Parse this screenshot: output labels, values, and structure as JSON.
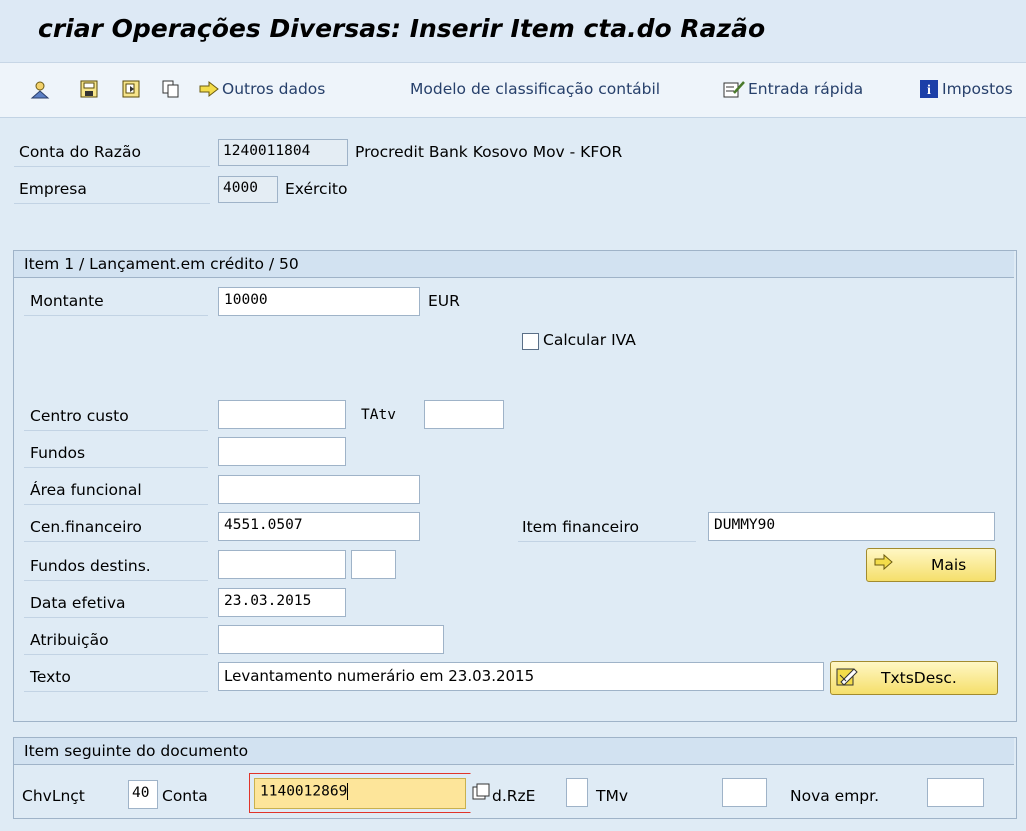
{
  "title": "criar Operações Diversas: Inserir Item cta.do Razão",
  "toolbar": {
    "icons": [
      "person-icon",
      "save-icon",
      "template-icon",
      "copy-icon"
    ],
    "outros_dados": "Outros dados",
    "modelo": "Modelo de classificação contábil",
    "entrada_rapida": "Entrada rápida",
    "impostos": "Impostos"
  },
  "header": {
    "conta_label": "Conta do Razão",
    "conta_value": "1240011804",
    "conta_desc": "Procredit Bank Kosovo Mov - KFOR",
    "empresa_label": "Empresa",
    "empresa_value": "4000",
    "empresa_desc": "Exército"
  },
  "item": {
    "heading": "Item 1 / Lançament.em crédito / 50",
    "montante_label": "Montante",
    "montante_value": "10000",
    "currency": "EUR",
    "calcular_iva": "Calcular IVA",
    "centro_custo_label": "Centro custo",
    "centro_custo_value": "",
    "tatv_label": "TAtv",
    "tatv_value": "",
    "fundos_label": "Fundos",
    "fundos_value": "",
    "area_label": "Área funcional",
    "area_value": "",
    "cenfin_label": "Cen.financeiro",
    "cenfin_value": "4551.0507",
    "itemfin_label": "Item financeiro",
    "itemfin_value": "DUMMY90",
    "mais_label": "Mais",
    "fundos_destins_label": "Fundos destins.",
    "fundos_destins_value": "",
    "fundos_destins_value2": "",
    "data_label": "Data efetiva",
    "data_value": "23.03.2015",
    "atribuicao_label": "Atribuição",
    "atribuicao_value": "",
    "texto_label": "Texto",
    "texto_value": "Levantamento numerário em 23.03.2015",
    "txtsdesc_label": "TxtsDesc."
  },
  "next": {
    "heading": "Item seguinte do documento",
    "chv_label": "ChvLnçt",
    "chv_value": "40",
    "conta_label": "Conta",
    "conta_value": "1140012869",
    "drze_label": "d.RzE",
    "drze_value": "",
    "tmv_label": "TMv",
    "tmv_value": "",
    "nova_label": "Nova empr.",
    "nova_value": ""
  }
}
